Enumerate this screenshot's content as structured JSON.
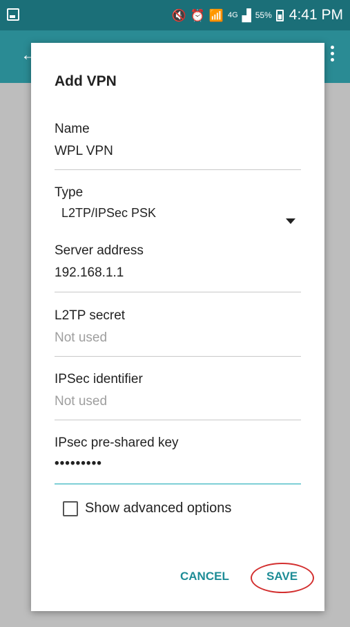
{
  "status_bar": {
    "battery": "55%",
    "clock": "4:41 PM",
    "network": "4G"
  },
  "dialog": {
    "title": "Add VPN",
    "fields": {
      "name": {
        "label": "Name",
        "value": "WPL VPN"
      },
      "type": {
        "label": "Type",
        "value": "L2TP/IPSec PSK"
      },
      "server": {
        "label": "Server address",
        "value": "192.168.1.1"
      },
      "l2tp_secret": {
        "label": "L2TP secret",
        "placeholder": "Not used"
      },
      "ipsec_identifier": {
        "label": "IPSec identifier",
        "placeholder": "Not used"
      },
      "preshared_key": {
        "label": "IPsec pre-shared key",
        "value": "•••••••••"
      }
    },
    "show_advanced": {
      "label": "Show advanced options",
      "checked": false
    },
    "buttons": {
      "cancel": "CANCEL",
      "save": "SAVE"
    }
  },
  "colors": {
    "status_bar": "#1b6f78",
    "app_bar": "#2a8b94",
    "accent": "#1d8c96",
    "highlight_circle": "#d32f2f"
  }
}
